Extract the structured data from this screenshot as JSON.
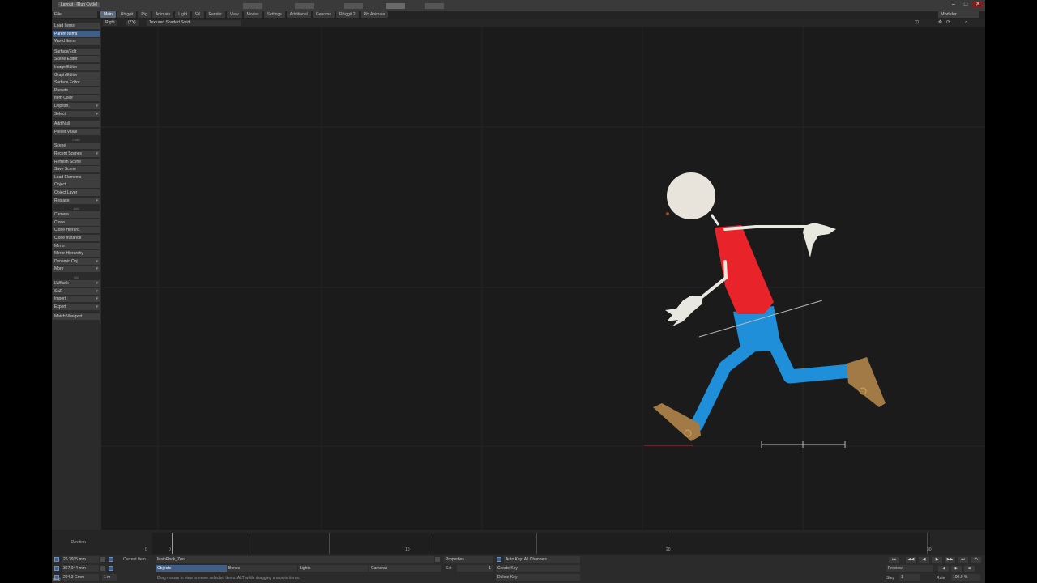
{
  "titlebar": {
    "title": "Layout - [Run Cycle]",
    "minimize": "–",
    "maximize": "□",
    "close": "✕"
  },
  "menu": {
    "layout_select": "File",
    "tabs": [
      {
        "label": "Main",
        "active": true
      },
      {
        "label": "Rhiggit"
      },
      {
        "label": "Rig"
      },
      {
        "label": "Animate"
      },
      {
        "label": "Light"
      },
      {
        "label": "FX"
      },
      {
        "label": "Render"
      },
      {
        "label": "View"
      },
      {
        "label": "Modes"
      },
      {
        "label": "Settings"
      },
      {
        "label": "Additional"
      },
      {
        "label": "Genoma"
      },
      {
        "label": "Rhiggit 2"
      },
      {
        "label": "RH Animate"
      }
    ],
    "modeler_button": "Modeler"
  },
  "sidebar": {
    "group1": [
      {
        "label": "Load Items"
      },
      {
        "label": "Parent Items",
        "active": true
      },
      {
        "label": "World Items"
      }
    ],
    "group2": [
      {
        "label": "Surface/Edit"
      },
      {
        "label": "Scene Editor"
      },
      {
        "label": "Image Editor"
      },
      {
        "label": "Graph Editor"
      },
      {
        "label": "Surface Editor"
      },
      {
        "label": "Presets"
      },
      {
        "label": "Item Color"
      },
      {
        "label": "Dopesh.",
        "dropdown": true
      },
      {
        "label": "Select",
        "dropdown": true
      }
    ],
    "group3": [
      {
        "label": "Add Null"
      },
      {
        "label": "Preset Value"
      }
    ],
    "group4_header": "Load",
    "group4": [
      {
        "label": "Scene"
      },
      {
        "label": "Recent Scenes",
        "dropdown": true
      },
      {
        "label": "Refresh Scene"
      },
      {
        "label": "Save Scene"
      },
      {
        "label": "Load Elements"
      },
      {
        "label": "Object"
      },
      {
        "label": "Object Layer"
      },
      {
        "label": "Replace",
        "dropdown": true
      }
    ],
    "group5_header": "Add",
    "group5": [
      {
        "label": "Camera"
      },
      {
        "label": "Clone"
      },
      {
        "label": "Clone Hierarc."
      },
      {
        "label": "Clone Instance"
      },
      {
        "label": "Mirror"
      },
      {
        "label": "Mirror Hierarchy"
      },
      {
        "label": "Dynamic Obj",
        "dropdown": true
      },
      {
        "label": "More",
        "dropdown": true
      }
    ],
    "group6_header": "Util",
    "group6": [
      {
        "label": "LWflunk",
        "dropdown": true
      },
      {
        "label": "SxZ",
        "dropdown": true
      },
      {
        "label": "Import",
        "dropdown": true
      },
      {
        "label": "Export",
        "dropdown": true
      }
    ],
    "group7": [
      {
        "label": "Match Viewport"
      }
    ]
  },
  "viewport": {
    "view_mode": "Right",
    "grid_mode": "(ZY)",
    "shading": "Textured Shaded Solid"
  },
  "timeline": {
    "frame_marks": [
      "0",
      "10",
      "20",
      "30"
    ],
    "current_frame": "0"
  },
  "bottom": {
    "position_label": "Position",
    "x_value": "26.3935 mm",
    "y_value": "367.044 mm",
    "z_value": "294.3 Gmm",
    "grid_label": "Grid",
    "grid_value": "1 m",
    "current_item_label": "Current Item",
    "current_item_value": "MainRock_Zuo",
    "properties": "Properties",
    "auto_key": "Auto Key: All Channels",
    "set_label": "Set",
    "set_value": "1",
    "create_key": "Create Key",
    "delete_key": "Delete Key",
    "item_types": [
      "Objects",
      "Bones",
      "Lights",
      "Cameras"
    ],
    "status_message": "Drag mouse in view to move selected items. ALT while dragging snaps to items.",
    "preview": "Preview",
    "step_label": "Step",
    "step_value": "1",
    "rate_label": "Rate",
    "rate_value": "100.0 %"
  },
  "colors": {
    "accent": "#3f5e88",
    "viewport_bg": "#1b1b1b",
    "shirt": "#e8242a",
    "pants": "#1e8fd8",
    "shoes": "#a27a45",
    "bones": "#e8e8e0"
  }
}
